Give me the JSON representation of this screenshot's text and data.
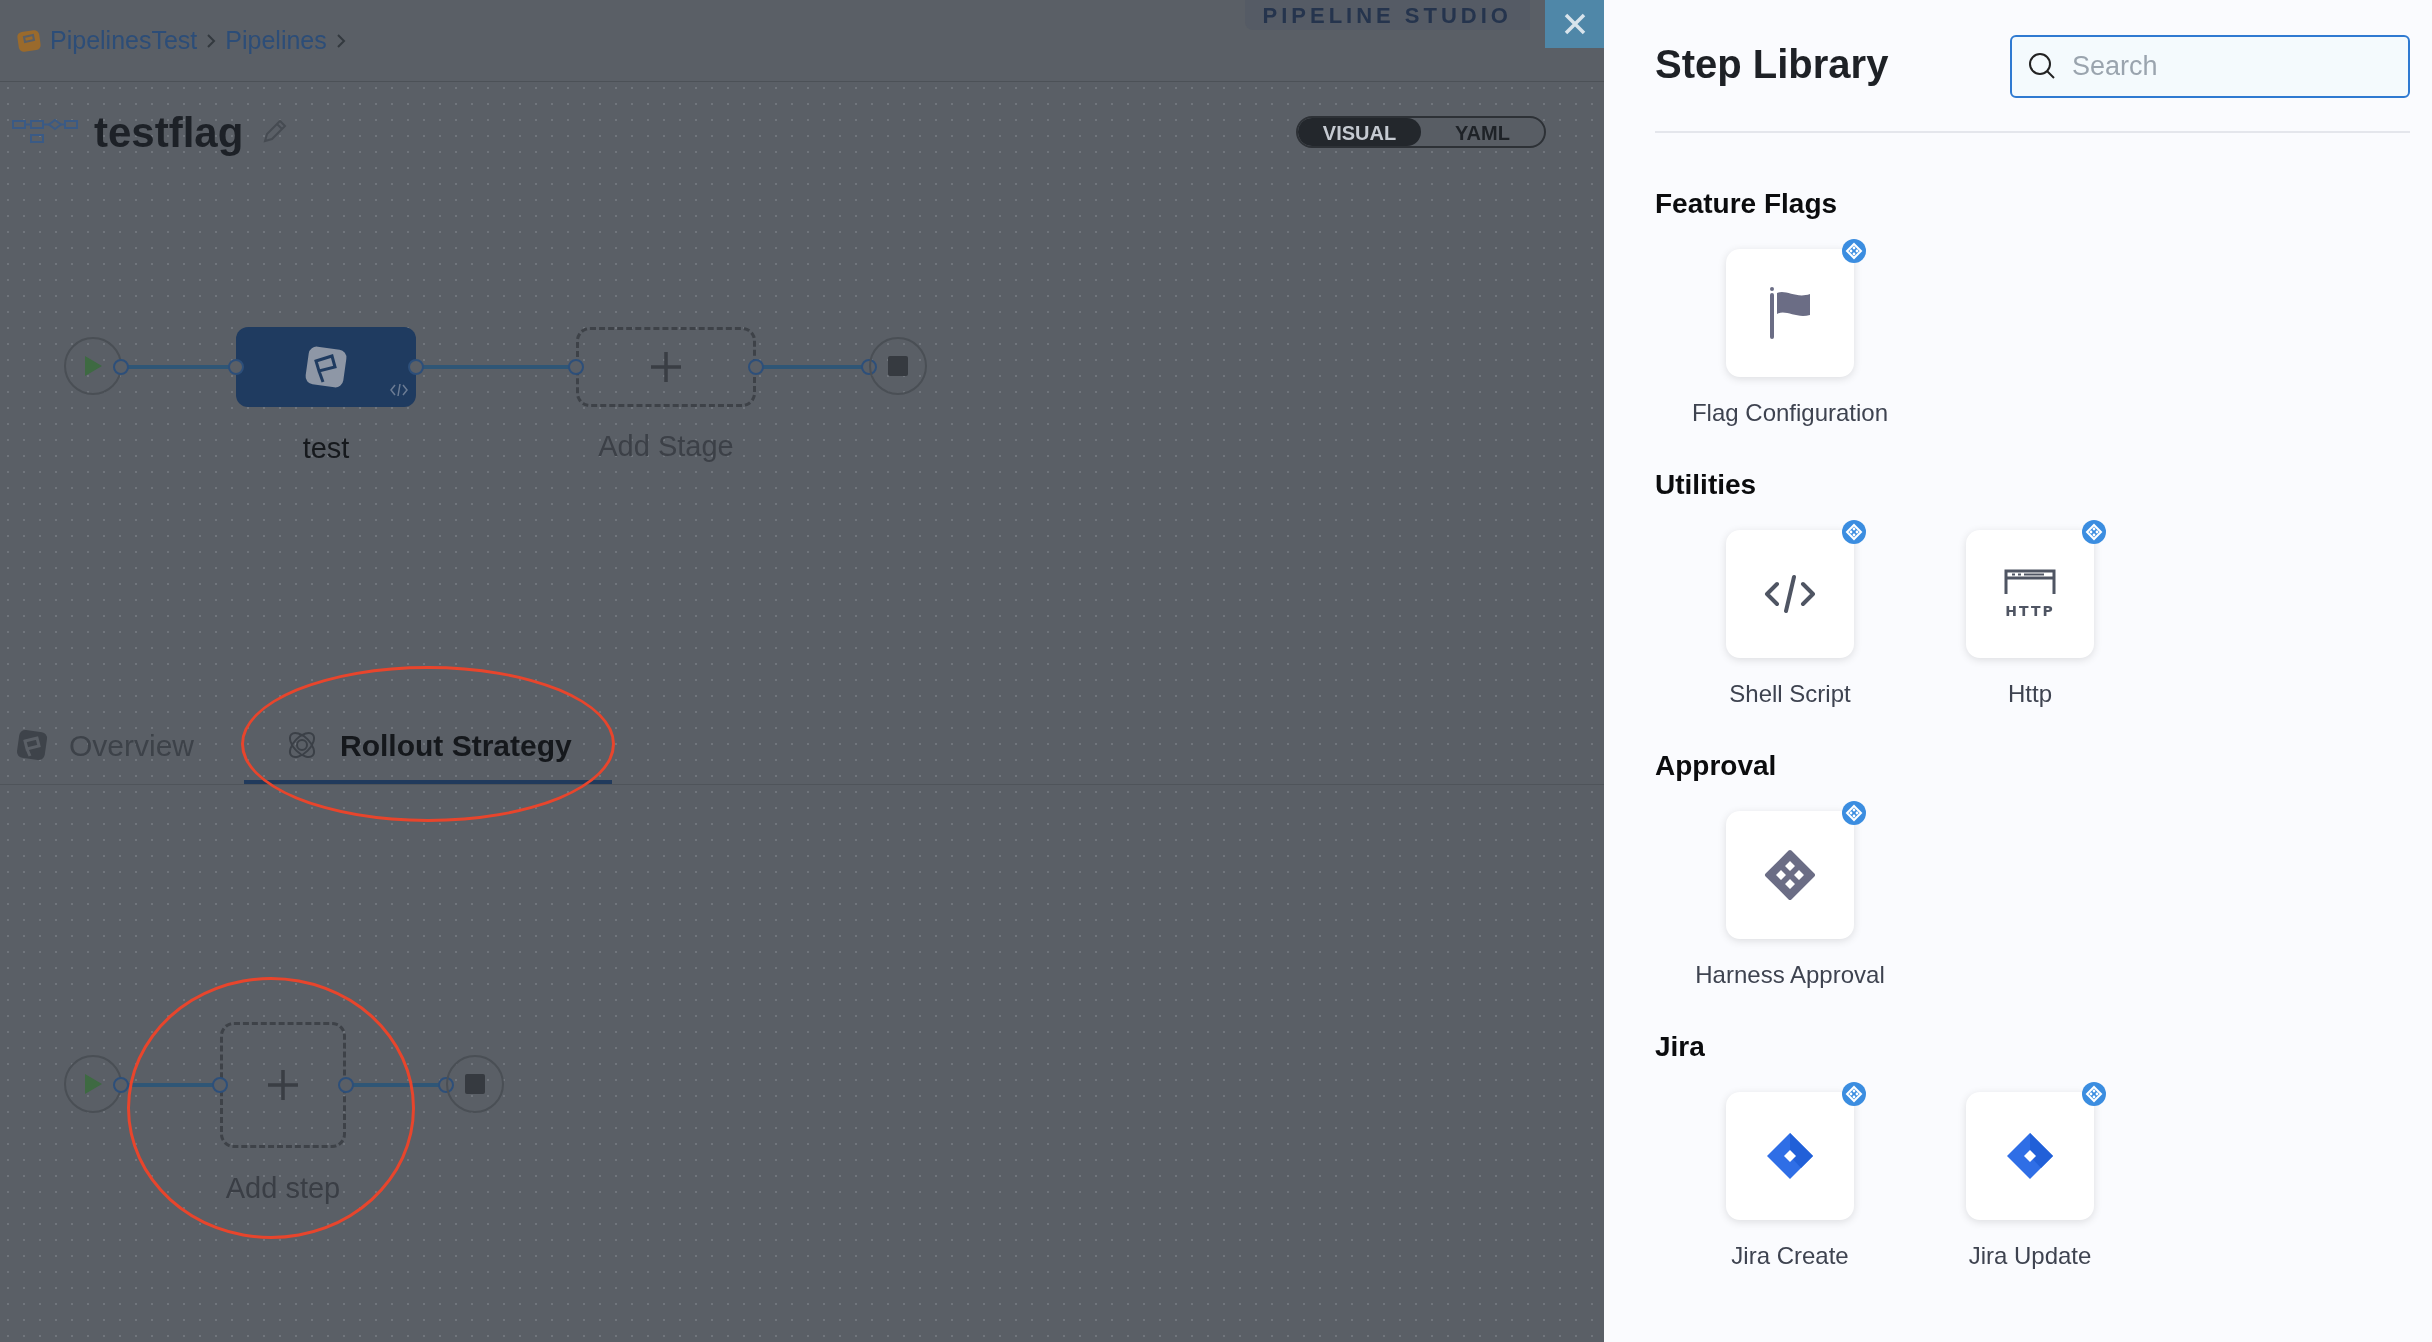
{
  "breadcrumbs": [
    {
      "label": "PipelinesTest"
    },
    {
      "label": "Pipelines"
    }
  ],
  "studio_label": "PIPELINE STUDIO",
  "pipeline": {
    "name": "testflag"
  },
  "view_toggle": [
    {
      "label": "VISUAL",
      "selected": true
    },
    {
      "label": "YAML",
      "selected": false
    }
  ],
  "stages": [
    {
      "name": "test",
      "kind": "stage"
    },
    {
      "name": "Add Stage",
      "kind": "add"
    }
  ],
  "stage_tabs": [
    {
      "label": "Overview",
      "selected": false,
      "circled": false
    },
    {
      "label": "Rollout Strategy",
      "selected": true,
      "circled": true
    }
  ],
  "steps": [
    {
      "name": "Add step",
      "kind": "add",
      "circled": true
    }
  ],
  "step_library": {
    "title": "Step Library",
    "search": {
      "placeholder": "Search"
    },
    "sections": [
      {
        "title": "Feature Flags",
        "items": [
          {
            "name": "Flag Configuration",
            "kind": "flag"
          }
        ]
      },
      {
        "title": "Utilities",
        "items": [
          {
            "name": "Shell Script",
            "kind": "script"
          },
          {
            "name": "Http",
            "kind": "http",
            "icon_label": "HTTP"
          }
        ]
      },
      {
        "title": "Approval",
        "items": [
          {
            "name": "Harness Approval",
            "kind": "approval"
          }
        ]
      },
      {
        "title": "Jira",
        "items": [
          {
            "name": "Jira Create",
            "kind": "jira"
          },
          {
            "name": "Jira Update",
            "kind": "jira"
          }
        ]
      }
    ]
  }
}
